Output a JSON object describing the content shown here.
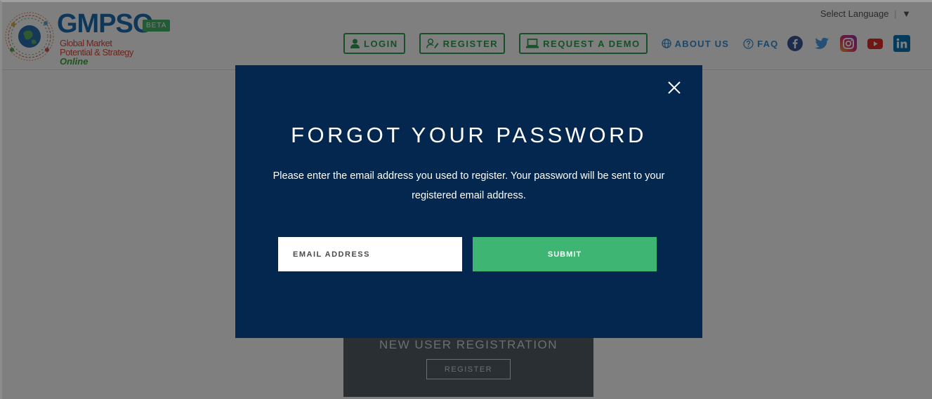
{
  "header": {
    "logo": {
      "title": "GMPSO",
      "badge": "BETA",
      "tagline_line1": "Global Market",
      "tagline_line2": "Potential & Strategy",
      "tagline_line3": "Online"
    },
    "language": {
      "label": "Select Language",
      "separator": "|",
      "arrow": "▼"
    },
    "nav": {
      "login": "LOGIN",
      "register": "REGISTER",
      "request_demo": "REQUEST A DEMO",
      "about": "ABOUT US",
      "faq": "FAQ"
    },
    "social": [
      "facebook",
      "twitter",
      "instagram",
      "youtube",
      "linkedin"
    ]
  },
  "background": {
    "registration_title": "NEW USER REGISTRATION",
    "registration_button": "REGISTER"
  },
  "modal": {
    "title": "FORGOT YOUR PASSWORD",
    "description": "Please enter the email address you used to register. Your password will be sent to your registered email address.",
    "email_placeholder": "EMAIL ADDRESS",
    "email_value": "",
    "submit_label": "SUBMIT"
  },
  "colors": {
    "modal_bg": "#042750",
    "accent_green": "#3fb574",
    "nav_green": "#2f9e4f",
    "nav_blue": "#3a8fd0"
  }
}
